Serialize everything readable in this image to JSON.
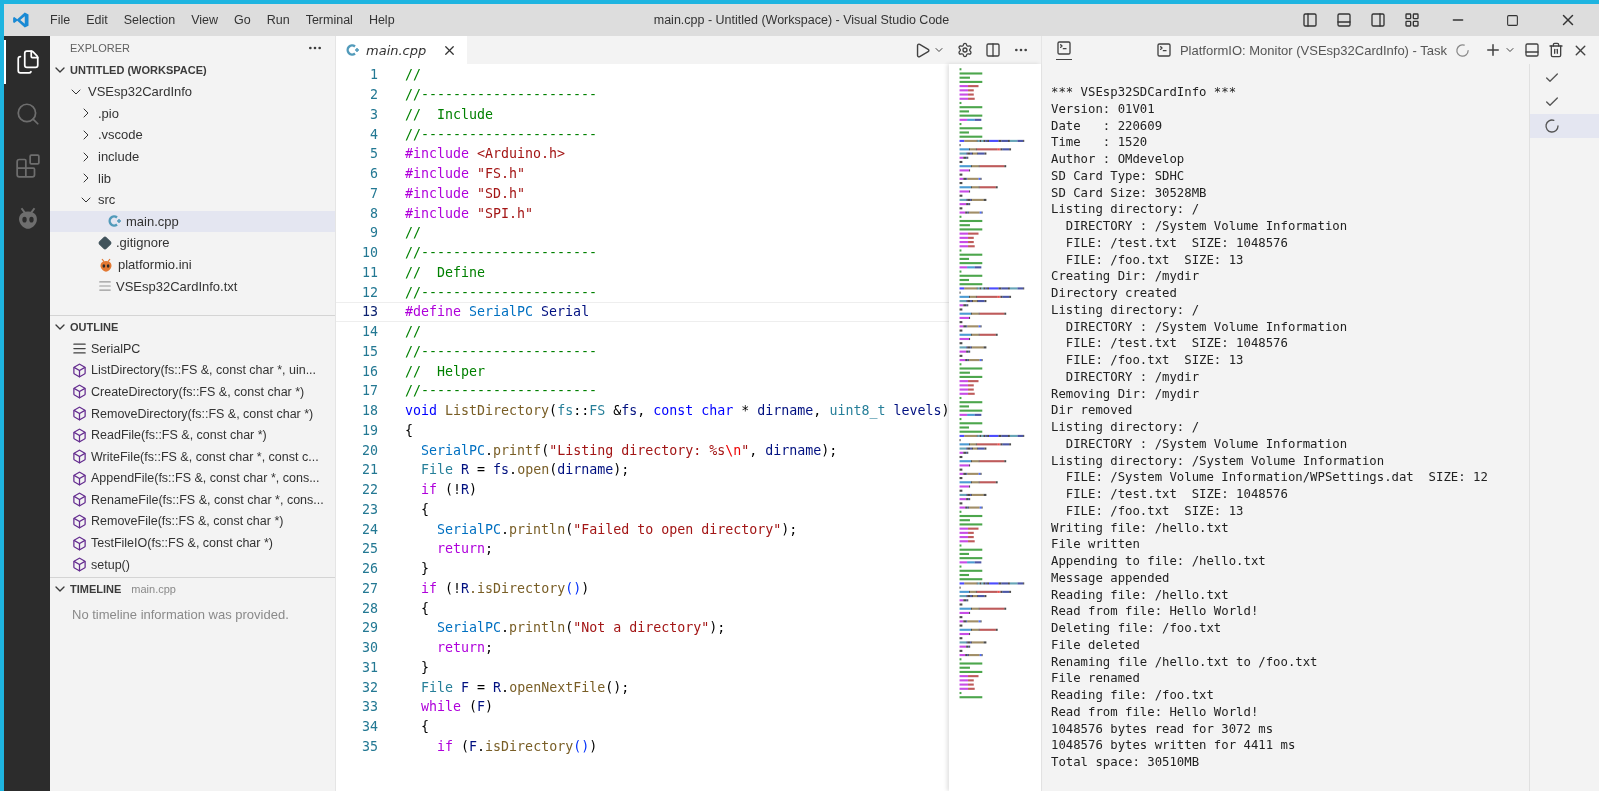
{
  "title_bar": {
    "menu": [
      "File",
      "Edit",
      "Selection",
      "View",
      "Go",
      "Run",
      "Terminal",
      "Help"
    ],
    "title": "main.cpp - Untitled (Workspace) - Visual Studio Code"
  },
  "activity_bar": {
    "items": [
      {
        "kind": "explorer",
        "selected": true
      },
      {
        "kind": "search",
        "selected": false
      },
      {
        "kind": "extensions",
        "selected": false
      },
      {
        "kind": "platformio",
        "selected": false
      }
    ]
  },
  "explorer": {
    "title": "EXPLORER",
    "workspace": {
      "label": "UNTITLED (WORKSPACE)",
      "expanded": true
    },
    "tree": [
      {
        "label": "VSEsp32CardInfo",
        "kind": "folder",
        "expanded": true,
        "selected": false,
        "children": [
          {
            "label": ".pio",
            "kind": "folder",
            "expanded": false,
            "selected": false
          },
          {
            "label": ".vscode",
            "kind": "folder",
            "expanded": false,
            "selected": false
          },
          {
            "label": "include",
            "kind": "folder",
            "expanded": false,
            "selected": false
          },
          {
            "label": "lib",
            "kind": "folder",
            "expanded": false,
            "selected": false
          },
          {
            "label": "src",
            "kind": "folder",
            "expanded": true,
            "selected": false,
            "children": [
              {
                "label": "main.cpp",
                "kind": "cpp",
                "selected": true
              }
            ]
          },
          {
            "label": ".gitignore",
            "kind": "git",
            "selected": false
          },
          {
            "label": "platformio.ini",
            "kind": "pio",
            "selected": false
          },
          {
            "label": "VSEsp32CardInfo.txt",
            "kind": "text",
            "selected": false
          }
        ]
      }
    ]
  },
  "outline": {
    "title": "OUTLINE",
    "expanded": true,
    "items": [
      {
        "kind": "constant",
        "label": "SerialPC"
      },
      {
        "kind": "function",
        "label": "ListDirectory(fs::FS &, const char *, uin..."
      },
      {
        "kind": "function",
        "label": "CreateDirectory(fs::FS &, const char *)"
      },
      {
        "kind": "function",
        "label": "RemoveDirectory(fs::FS &, const char *)"
      },
      {
        "kind": "function",
        "label": "ReadFile(fs::FS &, const char *)"
      },
      {
        "kind": "function",
        "label": "WriteFile(fs::FS &, const char *, const c..."
      },
      {
        "kind": "function",
        "label": "AppendFile(fs::FS &, const char *, cons..."
      },
      {
        "kind": "function",
        "label": "RenameFile(fs::FS &, const char *, cons..."
      },
      {
        "kind": "function",
        "label": "RemoveFile(fs::FS &, const char *)"
      },
      {
        "kind": "function",
        "label": "TestFileIO(fs::FS &, const char *)"
      },
      {
        "kind": "function",
        "label": "setup()"
      }
    ]
  },
  "timeline": {
    "title": "TIMELINE",
    "expanded": true,
    "file": "main.cpp",
    "message": "No timeline information was provided."
  },
  "editor": {
    "tabs": [
      {
        "label": "main.cpp",
        "selected": true,
        "preview": true
      }
    ],
    "lines": [
      {
        "number": "1",
        "current": false,
        "tokens": [
          {
            "kind": "comment",
            "text": "//"
          }
        ]
      },
      {
        "number": "2",
        "current": false,
        "tokens": [
          {
            "kind": "comment",
            "text": "//----------------------"
          }
        ]
      },
      {
        "number": "3",
        "current": false,
        "tokens": [
          {
            "kind": "comment",
            "text": "//  Include"
          }
        ]
      },
      {
        "number": "4",
        "current": false,
        "tokens": [
          {
            "kind": "comment",
            "text": "//----------------------"
          }
        ]
      },
      {
        "number": "5",
        "current": false,
        "tokens": [
          {
            "kind": "preproc",
            "text": "#include "
          },
          {
            "kind": "string",
            "text": "<Arduino.h>"
          }
        ]
      },
      {
        "number": "6",
        "current": false,
        "tokens": [
          {
            "kind": "preproc",
            "text": "#include "
          },
          {
            "kind": "string",
            "text": "\"FS.h\""
          }
        ]
      },
      {
        "number": "7",
        "current": false,
        "tokens": [
          {
            "kind": "preproc",
            "text": "#include "
          },
          {
            "kind": "string",
            "text": "\"SD.h\""
          }
        ]
      },
      {
        "number": "8",
        "current": false,
        "tokens": [
          {
            "kind": "preproc",
            "text": "#include "
          },
          {
            "kind": "string",
            "text": "\"SPI.h\""
          }
        ]
      },
      {
        "number": "9",
        "current": false,
        "tokens": [
          {
            "kind": "comment",
            "text": "//"
          }
        ]
      },
      {
        "number": "10",
        "current": false,
        "tokens": [
          {
            "kind": "comment",
            "text": "//----------------------"
          }
        ]
      },
      {
        "number": "11",
        "current": false,
        "tokens": [
          {
            "kind": "comment",
            "text": "//  Define"
          }
        ]
      },
      {
        "number": "12",
        "current": false,
        "tokens": [
          {
            "kind": "comment",
            "text": "//----------------------"
          }
        ]
      },
      {
        "number": "13",
        "current": true,
        "tokens": [
          {
            "kind": "preproc",
            "text": "#define "
          },
          {
            "kind": "macro",
            "text": "SerialPC"
          },
          {
            "kind": "var",
            "text": " Serial"
          }
        ]
      },
      {
        "number": "14",
        "current": false,
        "tokens": [
          {
            "kind": "comment",
            "text": "//"
          }
        ]
      },
      {
        "number": "15",
        "current": false,
        "tokens": [
          {
            "kind": "comment",
            "text": "//----------------------"
          }
        ]
      },
      {
        "number": "16",
        "current": false,
        "tokens": [
          {
            "kind": "comment",
            "text": "//  Helper"
          }
        ]
      },
      {
        "number": "17",
        "current": false,
        "tokens": [
          {
            "kind": "comment",
            "text": "//----------------------"
          }
        ]
      },
      {
        "number": "18",
        "current": false,
        "tokens": [
          {
            "kind": "keyword",
            "text": "void "
          },
          {
            "kind": "func",
            "text": "ListDirectory"
          },
          {
            "kind": "plain",
            "text": "("
          },
          {
            "kind": "type",
            "text": "fs"
          },
          {
            "kind": "plain",
            "text": "::"
          },
          {
            "kind": "type",
            "text": "FS"
          },
          {
            "kind": "plain",
            "text": " &"
          },
          {
            "kind": "var",
            "text": "fs"
          },
          {
            "kind": "plain",
            "text": ", "
          },
          {
            "kind": "keyword",
            "text": "const char"
          },
          {
            "kind": "plain",
            "text": " * "
          },
          {
            "kind": "var",
            "text": "dirname"
          },
          {
            "kind": "plain",
            "text": ", "
          },
          {
            "kind": "type",
            "text": "uint8_t "
          },
          {
            "kind": "var",
            "text": "levels"
          },
          {
            "kind": "plain",
            "text": ")"
          }
        ]
      },
      {
        "number": "19",
        "current": false,
        "tokens": [
          {
            "kind": "plain",
            "text": "{"
          }
        ]
      },
      {
        "number": "20",
        "current": false,
        "tokens": [
          {
            "kind": "macro",
            "text": "  SerialPC"
          },
          {
            "kind": "plain",
            "text": "."
          },
          {
            "kind": "func",
            "text": "printf"
          },
          {
            "kind": "plain",
            "text": "("
          },
          {
            "kind": "string",
            "text": "\"Listing directory: %s"
          },
          {
            "kind": "escape",
            "text": "\\n"
          },
          {
            "kind": "string",
            "text": "\""
          },
          {
            "kind": "plain",
            "text": ", "
          },
          {
            "kind": "var",
            "text": "dirname"
          },
          {
            "kind": "plain",
            "text": ");"
          }
        ]
      },
      {
        "number": "21",
        "current": false,
        "tokens": [
          {
            "kind": "type",
            "text": "  File "
          },
          {
            "kind": "var",
            "text": "R"
          },
          {
            "kind": "plain",
            "text": " = "
          },
          {
            "kind": "var",
            "text": "fs"
          },
          {
            "kind": "plain",
            "text": "."
          },
          {
            "kind": "func",
            "text": "open"
          },
          {
            "kind": "plain",
            "text": "("
          },
          {
            "kind": "var",
            "text": "dirname"
          },
          {
            "kind": "plain",
            "text": ");"
          }
        ]
      },
      {
        "number": "22",
        "current": false,
        "tokens": [
          {
            "kind": "control",
            "text": "  if"
          },
          {
            "kind": "plain",
            "text": " (!"
          },
          {
            "kind": "var",
            "text": "R"
          },
          {
            "kind": "plain",
            "text": ")"
          }
        ]
      },
      {
        "number": "23",
        "current": false,
        "tokens": [
          {
            "kind": "plain",
            "text": "  {"
          }
        ]
      },
      {
        "number": "24",
        "current": false,
        "tokens": [
          {
            "kind": "macro",
            "text": "    SerialPC"
          },
          {
            "kind": "plain",
            "text": "."
          },
          {
            "kind": "func",
            "text": "println"
          },
          {
            "kind": "plain",
            "text": "("
          },
          {
            "kind": "string",
            "text": "\"Failed to open directory\""
          },
          {
            "kind": "plain",
            "text": ");"
          }
        ]
      },
      {
        "number": "25",
        "current": false,
        "tokens": [
          {
            "kind": "control",
            "text": "    return"
          },
          {
            "kind": "plain",
            "text": ";"
          }
        ]
      },
      {
        "number": "26",
        "current": false,
        "tokens": [
          {
            "kind": "plain",
            "text": "  }"
          }
        ]
      },
      {
        "number": "27",
        "current": false,
        "tokens": [
          {
            "kind": "control",
            "text": "  if"
          },
          {
            "kind": "plain",
            "text": " (!"
          },
          {
            "kind": "var",
            "text": "R"
          },
          {
            "kind": "func",
            "text": ".isDirectory"
          },
          {
            "kind": "bracket",
            "text": "()"
          },
          {
            "kind": "plain",
            "text": ")"
          }
        ]
      },
      {
        "number": "28",
        "current": false,
        "tokens": [
          {
            "kind": "plain",
            "text": "  {"
          }
        ]
      },
      {
        "number": "29",
        "current": false,
        "tokens": [
          {
            "kind": "macro",
            "text": "    SerialPC"
          },
          {
            "kind": "plain",
            "text": "."
          },
          {
            "kind": "func",
            "text": "println"
          },
          {
            "kind": "plain",
            "text": "("
          },
          {
            "kind": "string",
            "text": "\"Not a directory\""
          },
          {
            "kind": "plain",
            "text": ");"
          }
        ]
      },
      {
        "number": "30",
        "current": false,
        "tokens": [
          {
            "kind": "control",
            "text": "    return"
          },
          {
            "kind": "plain",
            "text": ";"
          }
        ]
      },
      {
        "number": "31",
        "current": false,
        "tokens": [
          {
            "kind": "plain",
            "text": "  }"
          }
        ]
      },
      {
        "number": "32",
        "current": false,
        "tokens": [
          {
            "kind": "type",
            "text": "  File "
          },
          {
            "kind": "var",
            "text": "F"
          },
          {
            "kind": "plain",
            "text": " = "
          },
          {
            "kind": "var",
            "text": "R"
          },
          {
            "kind": "plain",
            "text": "."
          },
          {
            "kind": "func",
            "text": "openNextFile"
          },
          {
            "kind": "plain",
            "text": "();"
          }
        ]
      },
      {
        "number": "33",
        "current": false,
        "tokens": [
          {
            "kind": "control",
            "text": "  while"
          },
          {
            "kind": "plain",
            "text": " ("
          },
          {
            "kind": "var",
            "text": "F"
          },
          {
            "kind": "plain",
            "text": ")"
          }
        ]
      },
      {
        "number": "34",
        "current": false,
        "tokens": [
          {
            "kind": "plain",
            "text": "  {"
          }
        ]
      },
      {
        "number": "35",
        "current": false,
        "tokens": [
          {
            "kind": "control",
            "text": "    if"
          },
          {
            "kind": "plain",
            "text": " ("
          },
          {
            "kind": "var",
            "text": "F"
          },
          {
            "kind": "plain",
            "text": "."
          },
          {
            "kind": "func",
            "text": "isDirectory"
          },
          {
            "kind": "bracket",
            "text": "()"
          },
          {
            "kind": "plain",
            "text": ")"
          }
        ]
      }
    ]
  },
  "terminal": {
    "task": "PlatformIO: Monitor (VSEsp32CardInfo) - Task",
    "output": [
      "*** VSEsp32SDCardInfo ***",
      "Version: 01V01",
      "Date   : 220609",
      "Time   : 1520",
      "Author : OMdevelop",
      "SD Card Type: SDHC",
      "SD Card Size: 30528MB",
      "Listing directory: /",
      "  DIRECTORY : /System Volume Information",
      "  FILE: /test.txt  SIZE: 1048576",
      "  FILE: /foo.txt  SIZE: 13",
      "Creating Dir: /mydir",
      "Directory created",
      "Listing directory: /",
      "  DIRECTORY : /System Volume Information",
      "  FILE: /test.txt  SIZE: 1048576",
      "  FILE: /foo.txt  SIZE: 13",
      "  DIRECTORY : /mydir",
      "Removing Dir: /mydir",
      "Dir removed",
      "Listing directory: /",
      "  DIRECTORY : /System Volume Information",
      "Listing directory: /System Volume Information",
      "  FILE: /System Volume Information/WPSettings.dat  SIZE: 12",
      "  FILE: /test.txt  SIZE: 1048576",
      "  FILE: /foo.txt  SIZE: 13",
      "Writing file: /hello.txt",
      "File written",
      "Appending to file: /hello.txt",
      "Message appended",
      "Reading file: /hello.txt",
      "Read from file: Hello World!",
      "Deleting file: /foo.txt",
      "File deleted",
      "Renaming file /hello.txt to /foo.txt",
      "File renamed",
      "Reading file: /foo.txt",
      "Read from file: Hello World!",
      "1048576 bytes read for 3072 ms",
      "1048576 bytes written for 4411 ms",
      "Total space: 30510MB"
    ],
    "instances": [
      {
        "kind": "done",
        "selected": false
      },
      {
        "kind": "done",
        "selected": false
      },
      {
        "kind": "running",
        "selected": true
      }
    ]
  }
}
